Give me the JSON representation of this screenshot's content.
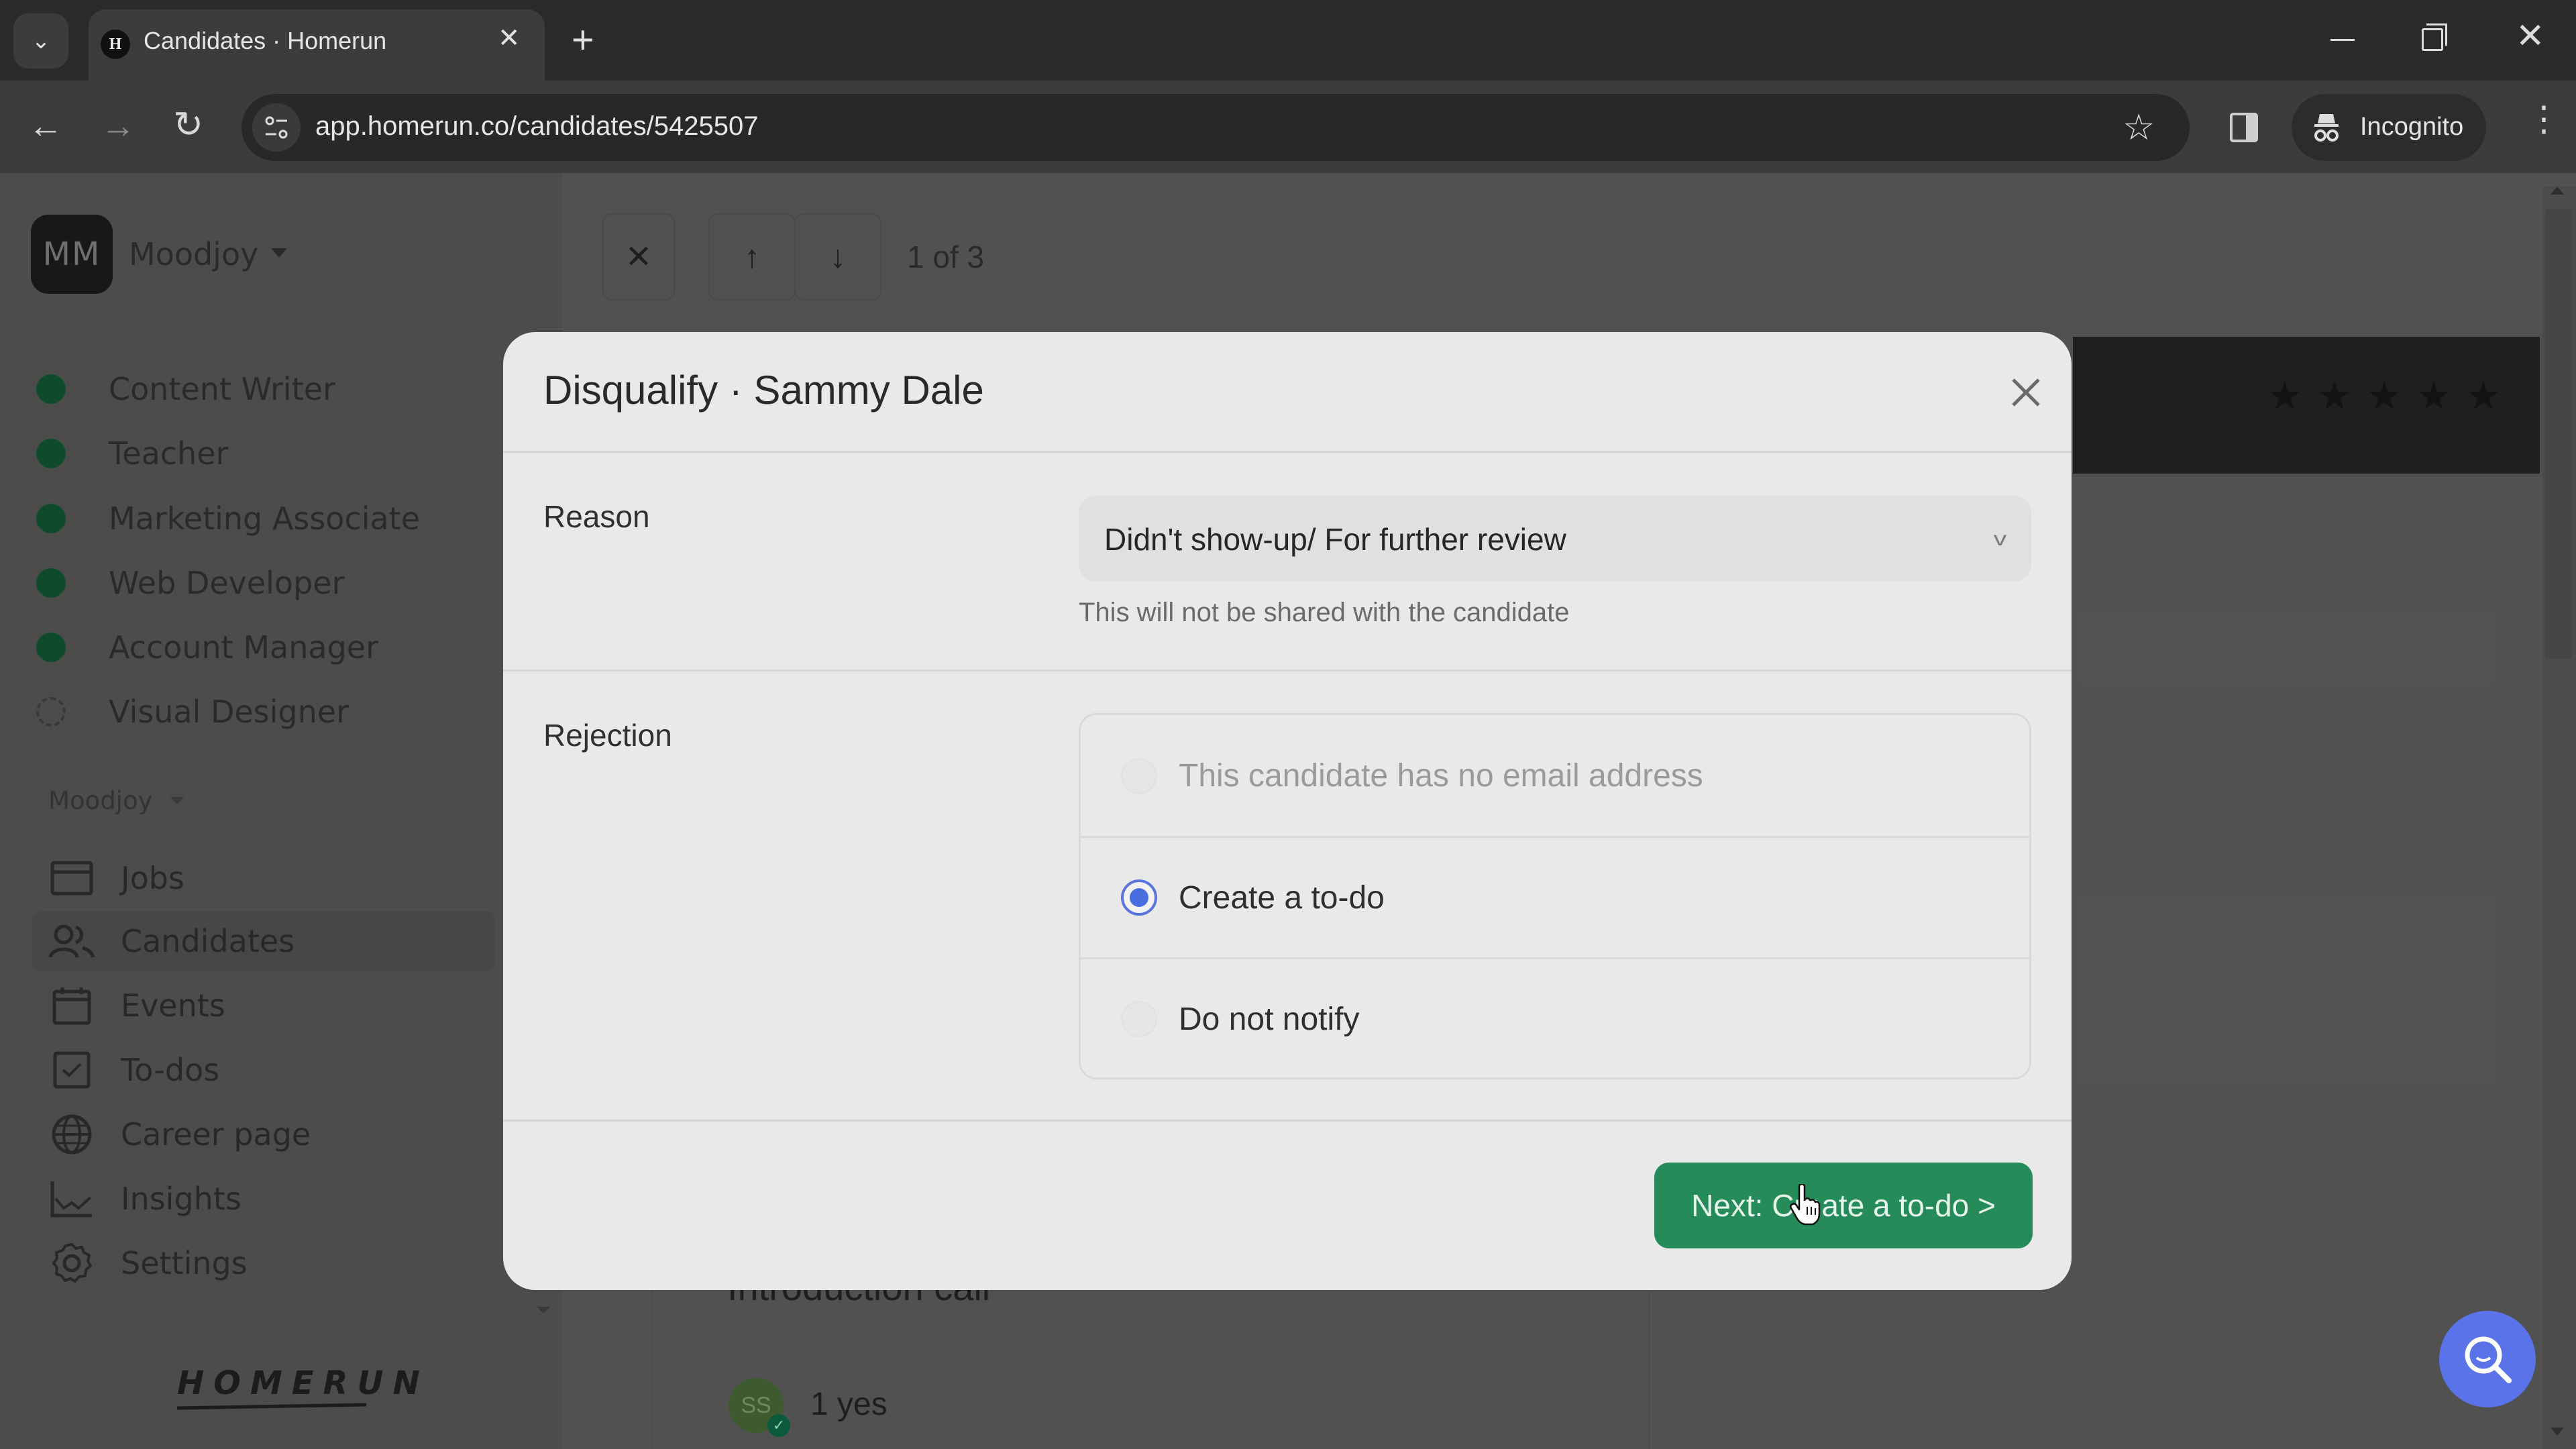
{
  "browser": {
    "tab_title": "Candidates · Homerun",
    "favicon_letter": "H",
    "url": "app.homerun.co/candidates/5425507",
    "profile_label": "Incognito",
    "icons": {
      "tab_search": "chevron-down-icon",
      "tab_close": "close-icon",
      "new_tab": "plus-icon",
      "back": "arrow-left-icon",
      "forward": "arrow-right-icon",
      "reload": "reload-icon",
      "site_info": "tune-icon",
      "bookmark": "star-outline-icon",
      "side_panel": "side-panel-icon",
      "incognito": "incognito-icon",
      "menu": "kebab-menu-icon"
    },
    "glyphs": {
      "tab_search": "⌄",
      "tab_close": "✕",
      "new_tab": "+",
      "back": "←",
      "forward": "→",
      "reload": "↻",
      "bookmark": "☆",
      "menu": "⋮",
      "window_close": "✕"
    }
  },
  "sidebar": {
    "org": {
      "initials": "MM",
      "name": "Moodjoy"
    },
    "jobs": [
      {
        "label": "Content Writer",
        "status": "published"
      },
      {
        "label": "Teacher",
        "status": "published"
      },
      {
        "label": "Marketing Associate",
        "status": "published"
      },
      {
        "label": "Web Developer",
        "status": "published"
      },
      {
        "label": "Account Manager",
        "status": "published"
      },
      {
        "label": "Visual Designer",
        "status": "draft"
      }
    ],
    "section_label": "Moodjoy",
    "nav": [
      {
        "label": "Jobs",
        "icon": "briefcase-icon",
        "active": false
      },
      {
        "label": "Candidates",
        "icon": "users-icon",
        "active": true
      },
      {
        "label": "Events",
        "icon": "calendar-icon",
        "active": false
      },
      {
        "label": "To-dos",
        "icon": "checkbox-icon",
        "active": false
      },
      {
        "label": "Career page",
        "icon": "globe-icon",
        "active": false
      },
      {
        "label": "Insights",
        "icon": "chart-line-icon",
        "active": false
      },
      {
        "label": "Settings",
        "icon": "gear-icon",
        "active": false
      }
    ],
    "brand": "HOMERUN"
  },
  "candidate_view": {
    "pager": "1 of 3",
    "close_glyph": "✕",
    "prev_glyph": "↑",
    "next_glyph": "↓",
    "rating_stars": 5,
    "star_glyph": "★",
    "timeline_title": "Introduction call",
    "vote_avatar_initials": "SS",
    "vote_text": "1 yes"
  },
  "modal": {
    "title": "Disqualify · Sammy Dale",
    "close_glyph": "✕",
    "reason": {
      "label": "Reason",
      "selected": "Didn't show-up/ For further review",
      "caret": "v",
      "helper": "This will not be shared with the candidate"
    },
    "rejection": {
      "label": "Rejection",
      "options": [
        {
          "label": "This candidate has no email address",
          "checked": false,
          "disabled": true
        },
        {
          "label": "Create a to-do",
          "checked": true,
          "disabled": false
        },
        {
          "label": "Do not notify",
          "checked": false,
          "disabled": false
        }
      ]
    },
    "next_button": "Next: Create a to-do >"
  },
  "colors": {
    "primary_green": "#258b59",
    "radio_blue": "#4a6ee0",
    "fab_blue": "#5a73e8",
    "job_published_dot": "#0f4a2c"
  }
}
